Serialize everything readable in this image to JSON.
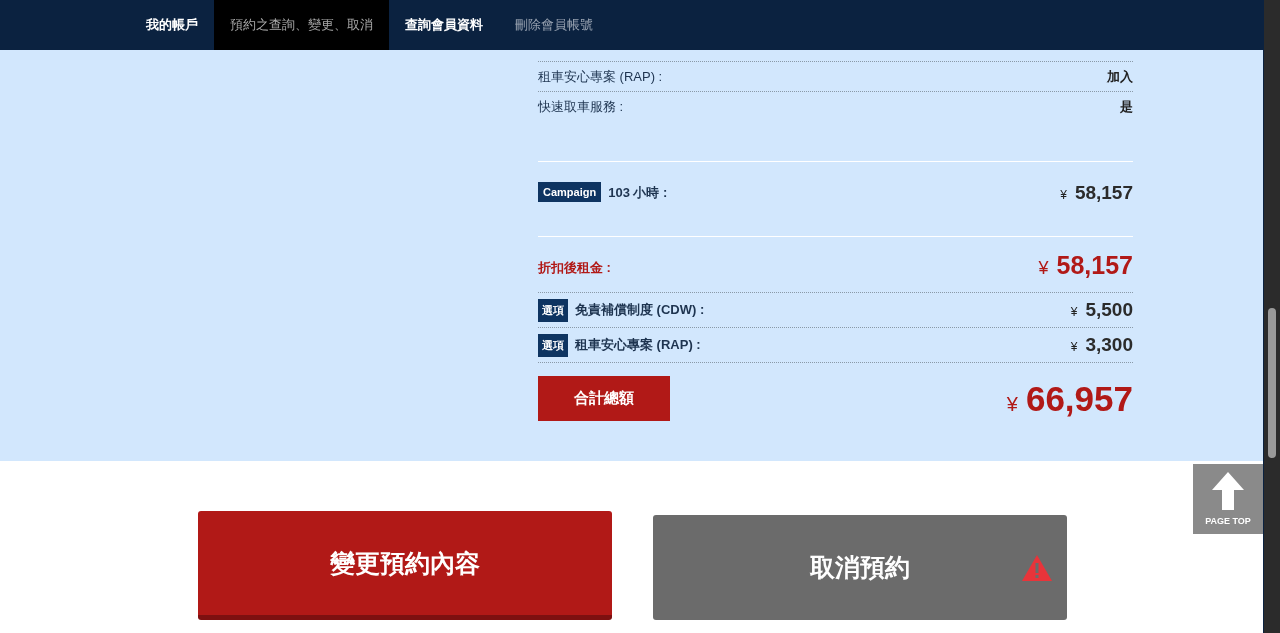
{
  "nav": {
    "tabs": [
      {
        "label": "我的帳戶",
        "selected": false
      },
      {
        "label": "預約之查詢、變更、取消",
        "selected": true
      },
      {
        "label": "查詢會員資料",
        "selected": false
      },
      {
        "label": "刪除會員帳號",
        "selected": false,
        "disabled": true
      }
    ]
  },
  "details": [
    {
      "label": "租車安心專案 (RAP) :",
      "value": "加入"
    },
    {
      "label": "快速取車服務 :",
      "value": "是"
    }
  ],
  "campaign": {
    "badge": "Campaign",
    "label": "103 小時 :",
    "currency": "¥",
    "amount": "58,157"
  },
  "discounted": {
    "label": "折扣後租金 :",
    "currency": "¥",
    "amount": "58,157"
  },
  "options": [
    {
      "badge": "選項",
      "label": "免責補償制度 (CDW) :",
      "currency": "¥",
      "amount": "5,500"
    },
    {
      "badge": "選項",
      "label": "租車安心專案 (RAP) :",
      "currency": "¥",
      "amount": "3,300"
    }
  ],
  "total": {
    "label": "合計總額",
    "currency": "¥",
    "amount": "66,957"
  },
  "actions": [
    {
      "label": "變更預約內容",
      "kind": "primary",
      "warning": false
    },
    {
      "label": "取消預約",
      "kind": "secondary",
      "warning": true
    }
  ],
  "page_top": {
    "label": "PAGE TOP"
  }
}
